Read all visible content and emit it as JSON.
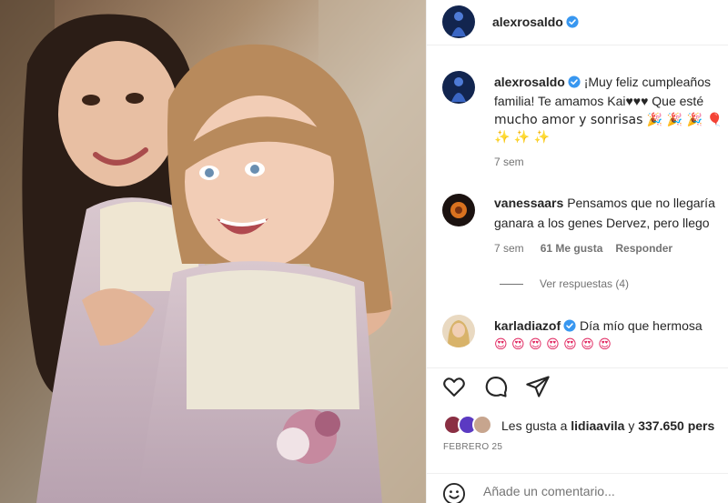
{
  "post": {
    "author": "alexrosaldo"
  },
  "caption": {
    "username": "alexrosaldo",
    "line1": "¡Muy feliz cumpleaños",
    "line2": "familia! Te amamos Kai♥♥♥ Que esté",
    "line3": "mucho amor y sonrisas 🎉 🎉 🎉 🎈",
    "line4": "✨ ✨ ✨",
    "time": "7 sem"
  },
  "comments": [
    {
      "username": "vanessaars",
      "line1": "Pensamos que no llegaría",
      "line2": "ganara a los genes Dervez, pero llego",
      "time": "7 sem",
      "likes": "61 Me gusta",
      "reply": "Responder"
    },
    {
      "username": "karladiazof",
      "line1": "Día mío que hermosa",
      "line2": "😍 😍 😍 😍 😍 😍 😍"
    }
  ],
  "view_replies": "Ver respuestas (4)",
  "likes": {
    "prefix": "Les gusta a",
    "user": "lidiaavila",
    "middle": "y",
    "count": "337.650 pers"
  },
  "date": "FEBRERO 25",
  "add_comment": {
    "placeholder": "Añade un comentario..."
  },
  "icons": {
    "like": "heart-icon",
    "comment": "comment-icon",
    "share": "share-icon",
    "emoji": "emoji-icon",
    "verified": "verified-badge-icon"
  },
  "colors": {
    "verified": "#3897f0",
    "text": "#262626",
    "muted": "#737373"
  }
}
